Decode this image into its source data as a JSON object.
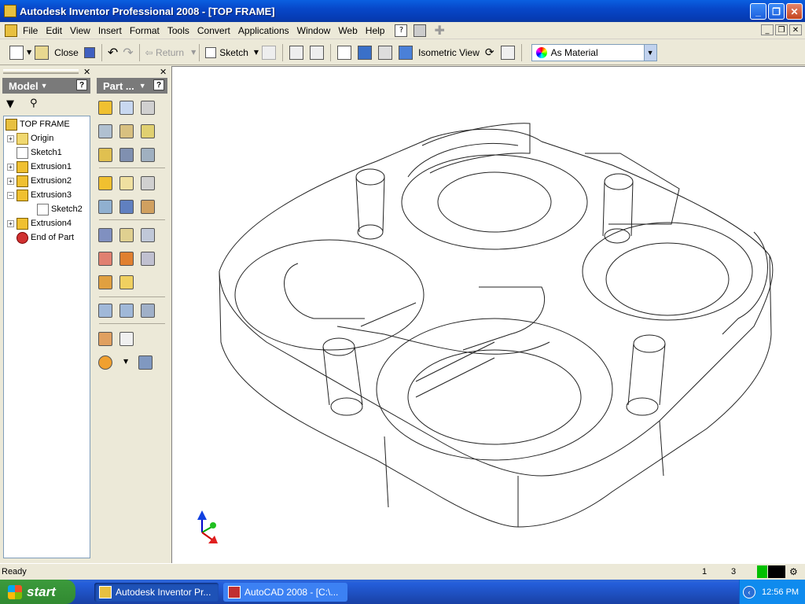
{
  "window": {
    "title": "Autodesk Inventor Professional 2008 - [TOP FRAME]"
  },
  "menu": [
    "File",
    "Edit",
    "View",
    "Insert",
    "Format",
    "Tools",
    "Convert",
    "Applications",
    "Window",
    "Web",
    "Help"
  ],
  "toolbar": {
    "close_label": "Close",
    "return_label": "Return",
    "sketch_label": "Sketch",
    "view_label": "Isometric View",
    "style_value": "As Material"
  },
  "browser": {
    "header": "Model",
    "tree": [
      {
        "label": "TOP FRAME",
        "icon": "part-icon"
      },
      {
        "label": "Origin",
        "icon": "folder-icon"
      },
      {
        "label": "Sketch1",
        "icon": "sketch-icon"
      },
      {
        "label": "Extrusion1",
        "icon": "extrusion-icon"
      },
      {
        "label": "Extrusion2",
        "icon": "extrusion-icon"
      },
      {
        "label": "Extrusion3",
        "icon": "extrusion-icon"
      },
      {
        "label": "Sketch2",
        "icon": "sketch-icon"
      },
      {
        "label": "Extrusion4",
        "icon": "extrusion-icon"
      },
      {
        "label": "End of Part",
        "icon": "end-of-part-icon"
      }
    ]
  },
  "panel": {
    "header": "Part ..."
  },
  "status": {
    "text": "Ready",
    "num1": "1",
    "num2": "3"
  },
  "taskbar": {
    "start_label": "start",
    "tasks": [
      "Autodesk Inventor Pr...",
      "AutoCAD 2008 - [C:\\..."
    ],
    "clock": "12:56 PM"
  },
  "colors": {
    "titlebar": "#0a5fe0",
    "taskbar": "#245edb",
    "start": "#3c9a3c",
    "status_green": "#00c000"
  }
}
